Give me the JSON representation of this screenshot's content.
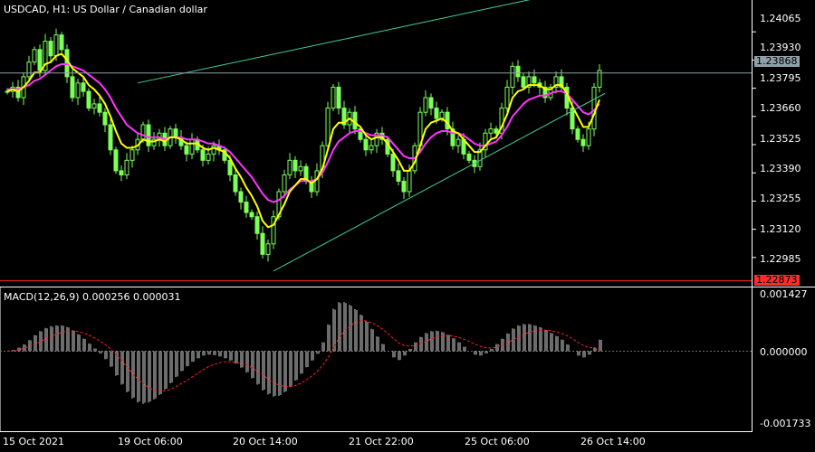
{
  "header": {
    "title": "USDCAD, H1:  US Dollar / Canadian dollar",
    "macd_title": "MACD(12,26,9) 0.000256 0.000031"
  },
  "colors": {
    "background": "#000000",
    "candles": "#7dff5a",
    "ma_fast": "#ffff00",
    "ma_slow": "#ff33ff",
    "trendlines": "#3fd19a",
    "bid_line": "#8fa0a8",
    "low_line": "#ff2a2a",
    "macd_hist": "#d8d8d8",
    "macd_signal": "#ff2020"
  },
  "price_axis": {
    "ticks": [
      "1.24065",
      "1.23930",
      "1.23795",
      "1.23660",
      "1.23525",
      "1.23390",
      "1.23255",
      "1.23120",
      "1.22985"
    ],
    "current_price_label": "1.23868",
    "low_label": "1.22873"
  },
  "macd_axis": {
    "ticks": [
      "0.001427",
      "0.000000",
      "-0.001733"
    ]
  },
  "time_axis": {
    "ticks": [
      "15 Oct 2021",
      "19 Oct 06:00",
      "20 Oct 14:00",
      "21 Oct 22:00",
      "25 Oct 06:00",
      "26 Oct 14:00"
    ]
  },
  "chart_data": {
    "type": "line",
    "title": "USDCAD, H1:  US Dollar / Canadian dollar",
    "symbol": "USDCAD",
    "timeframe": "H1",
    "x_labels": [
      "15 Oct 2021",
      "19 Oct 06:00",
      "20 Oct 14:00",
      "21 Oct 22:00",
      "25 Oct 06:00",
      "26 Oct 14:00"
    ],
    "ylim": [
      1.2285,
      1.242
    ],
    "current_price": 1.23868,
    "low_line": 1.22873,
    "bar_count": 110,
    "series": [
      {
        "style": "candles",
        "close": [
          1.2378,
          1.238,
          1.2375,
          1.2385,
          1.2392,
          1.2398,
          1.2388,
          1.2402,
          1.2395,
          1.2405,
          1.2398,
          1.2385,
          1.2375,
          1.2382,
          1.2378,
          1.237,
          1.2372,
          1.2368,
          1.2362,
          1.235,
          1.234,
          1.2338,
          1.2345,
          1.235,
          1.2355,
          1.2362,
          1.2352,
          1.2355,
          1.2358,
          1.2352,
          1.236,
          1.2356,
          1.2352,
          1.2348,
          1.2355,
          1.235,
          1.2345,
          1.2348,
          1.2352,
          1.235,
          1.2345,
          1.2338,
          1.233,
          1.2325,
          1.232,
          1.2318,
          1.231,
          1.23,
          1.2305,
          1.2318,
          1.233,
          1.2338,
          1.2345,
          1.234,
          1.2342,
          1.2335,
          1.233,
          1.234,
          1.2352,
          1.237,
          1.238,
          1.237,
          1.2362,
          1.2368,
          1.236,
          1.2355,
          1.235,
          1.2352,
          1.2358,
          1.2355,
          1.2348,
          1.234,
          1.2335,
          1.233,
          1.234,
          1.2352,
          1.2368,
          1.2375,
          1.237,
          1.2365,
          1.2368,
          1.236,
          1.2352,
          1.2355,
          1.2348,
          1.2345,
          1.2342,
          1.235,
          1.2358,
          1.236,
          1.2358,
          1.237,
          1.238,
          1.239,
          1.2385,
          1.238,
          1.2385,
          1.2382,
          1.238,
          1.2375,
          1.238,
          1.2385,
          1.238,
          1.237,
          1.236,
          1.2355,
          1.2352,
          1.236,
          1.238,
          1.2388
        ]
      },
      {
        "name": "",
        "style": "line",
        "color": "#ffff00",
        "values": [
          1.2378,
          1.2379,
          1.2378,
          1.238,
          1.2383,
          1.2387,
          1.2387,
          1.2391,
          1.2392,
          1.2395,
          1.2396,
          1.2393,
          1.2389,
          1.2387,
          1.2385,
          1.2381,
          1.2379,
          1.2376,
          1.2372,
          1.2366,
          1.2359,
          1.2353,
          1.2351,
          1.2351,
          1.2352,
          1.2355,
          1.2354,
          1.2354,
          1.2355,
          1.2354,
          1.2356,
          1.2356,
          1.2355,
          1.2353,
          1.2353,
          1.2353,
          1.2351,
          1.235,
          1.2351,
          1.235,
          1.2349,
          1.2346,
          1.2341,
          1.2337,
          1.2332,
          1.2328,
          1.2323,
          1.2316,
          1.2313,
          1.2314,
          1.2319,
          1.2324,
          1.233,
          1.2333,
          1.2336,
          1.2336,
          1.2334,
          1.2336,
          1.2341,
          1.235,
          1.236,
          1.2363,
          1.2363,
          1.2365,
          1.2363,
          1.2361,
          1.2357,
          1.2355,
          1.2356,
          1.2356,
          1.2353,
          1.2349,
          1.2345,
          1.234,
          1.234,
          1.2344,
          1.2352,
          1.236,
          1.2363,
          1.2364,
          1.2365,
          1.2363,
          1.2359,
          1.2358,
          1.2355,
          1.2352,
          1.2349,
          1.2349,
          1.2352,
          1.2355,
          1.2356,
          1.2361,
          1.2367,
          1.2375,
          1.2378,
          1.2379,
          1.2381,
          1.2381,
          1.2381,
          1.2379,
          1.2379,
          1.2381,
          1.2381,
          1.2377,
          1.2371,
          1.2366,
          1.2361,
          1.2361,
          1.2367,
          1.2374
        ]
      },
      {
        "name": "",
        "style": "line",
        "color": "#ff33ff",
        "values": [
          1.2379,
          1.2379,
          1.2379,
          1.238,
          1.2381,
          1.2383,
          1.2384,
          1.2386,
          1.2388,
          1.239,
          1.2391,
          1.2391,
          1.239,
          1.2389,
          1.2388,
          1.2386,
          1.2384,
          1.2382,
          1.2379,
          1.2375,
          1.237,
          1.2366,
          1.2362,
          1.236,
          1.2358,
          1.2357,
          1.2356,
          1.2356,
          1.2356,
          1.2355,
          1.2356,
          1.2356,
          1.2356,
          1.2355,
          1.2355,
          1.2355,
          1.2354,
          1.2353,
          1.2353,
          1.2352,
          1.2351,
          1.2349,
          1.2346,
          1.2343,
          1.234,
          1.2337,
          1.2333,
          1.2329,
          1.2326,
          1.2325,
          1.2326,
          1.2328,
          1.2331,
          1.2333,
          1.2335,
          1.2335,
          1.2335,
          1.2336,
          1.2339,
          1.2344,
          1.235,
          1.2354,
          1.2356,
          1.2358,
          1.2359,
          1.2359,
          1.2358,
          1.2357,
          1.2357,
          1.2357,
          1.2356,
          1.2353,
          1.235,
          1.2347,
          1.2346,
          1.2346,
          1.2349,
          1.2353,
          1.2356,
          1.2358,
          1.2359,
          1.2359,
          1.2358,
          1.2358,
          1.2357,
          1.2355,
          1.2353,
          1.2352,
          1.2352,
          1.2353,
          1.2354,
          1.2357,
          1.2361,
          1.2366,
          1.2369,
          1.2372,
          1.2374,
          1.2375,
          1.2376,
          1.2376,
          1.2377,
          1.2378,
          1.2378,
          1.2377,
          1.2374,
          1.2371,
          1.2368,
          1.2367,
          1.2369,
          1.2372
        ]
      }
    ],
    "trendlines": [
      {
        "from": [
          24,
          1.2382
        ],
        "to": [
          100,
          1.2424
        ]
      },
      {
        "from": [
          49,
          1.2292
        ],
        "to": [
          110,
          1.2377
        ]
      }
    ],
    "macd": {
      "ylim": [
        -0.001733,
        0.001427
      ],
      "name": "MACD(12,26,9)",
      "last_macd": 0.000256,
      "last_signal": 3.1e-05,
      "histogram": [
        0.0,
        3e-05,
        8e-05,
        0.00015,
        0.00025,
        0.00036,
        0.00045,
        0.00052,
        0.00056,
        0.00058,
        0.00058,
        0.00054,
        0.00047,
        0.00038,
        0.00028,
        0.00017,
        6e-05,
        -5e-05,
        -0.00018,
        -0.00035,
        -0.00055,
        -0.00075,
        -0.00092,
        -0.00106,
        -0.00115,
        -0.00118,
        -0.00115,
        -0.00108,
        -0.00098,
        -0.00086,
        -0.00072,
        -0.00058,
        -0.00045,
        -0.00034,
        -0.00024,
        -0.00016,
        -0.0001,
        -8e-05,
        -9e-05,
        -0.00012,
        -0.00016,
        -0.00021,
        -0.00028,
        -0.00037,
        -0.00048,
        -0.00061,
        -0.00075,
        -0.00088,
        -0.00097,
        -0.00102,
        -0.001,
        -0.00092,
        -0.0008,
        -0.00066,
        -0.00051,
        -0.00036,
        -0.00021,
        -6e-05,
        0.0002,
        0.0006,
        0.00095,
        0.0011,
        0.0011,
        0.00104,
        0.00094,
        0.00082,
        0.00067,
        0.0005,
        0.00033,
        0.00016,
        0.0,
        -0.00014,
        -0.0002,
        -0.0001,
        5e-05,
        0.0002,
        0.00032,
        0.00041,
        0.00045,
        0.00046,
        0.00043,
        0.00037,
        0.00029,
        0.0002,
        0.0001,
        0.0,
        -8e-05,
        -0.0001,
        -5e-05,
        5e-05,
        0.00016,
        0.00028,
        0.0004,
        0.00051,
        0.00058,
        0.00061,
        0.00061,
        0.00058,
        0.00054,
        0.00048,
        0.00041,
        0.00034,
        0.00026,
        0.00015,
        0.0,
        -0.0001,
        -0.00014,
        -8e-05,
        8e-05,
        0.00026
      ],
      "signal": [
        0.0,
        1e-05,
        3e-05,
        6e-05,
        0.0001,
        0.00015,
        0.00021,
        0.00027,
        0.00033,
        0.00038,
        0.00042,
        0.00045,
        0.00045,
        0.00044,
        0.00041,
        0.00036,
        0.0003,
        0.00023,
        0.00015,
        5e-05,
        -7e-05,
        -0.00021,
        -0.00035,
        -0.00049,
        -0.00062,
        -0.00073,
        -0.00081,
        -0.00087,
        -0.00089,
        -0.00089,
        -0.00086,
        -0.0008,
        -0.00073,
        -0.00066,
        -0.00058,
        -0.0005,
        -0.00042,
        -0.00035,
        -0.0003,
        -0.00026,
        -0.00024,
        -0.00024,
        -0.00025,
        -0.00027,
        -0.00031,
        -0.00037,
        -0.00045,
        -0.00053,
        -0.00062,
        -0.0007,
        -0.00076,
        -0.00079,
        -0.0008,
        -0.00077,
        -0.00072,
        -0.00065,
        -0.00056,
        -0.00046,
        -0.00033,
        -0.00015,
        7e-05,
        0.00028,
        0.00044,
        0.00056,
        0.00064,
        0.00068,
        0.00068,
        0.00064,
        0.00058,
        0.0005,
        0.0004,
        0.00029,
        0.00019,
        0.00013,
        0.00011,
        0.00013,
        0.00017,
        0.00022,
        0.00027,
        0.00031,
        0.00034,
        0.00035,
        0.00034,
        0.00031,
        0.00027,
        0.00022,
        0.00016,
        0.00011,
        8e-05,
        7e-05,
        9e-05,
        0.00013,
        0.00018,
        0.00025,
        0.00031,
        0.00037,
        0.00042,
        0.00045,
        0.00047,
        0.00047,
        0.00046,
        0.00043,
        0.0004,
        0.00035,
        0.00028,
        0.0002,
        0.00013,
        8e-05,
        8e-05,
        3e-05
      ]
    }
  }
}
